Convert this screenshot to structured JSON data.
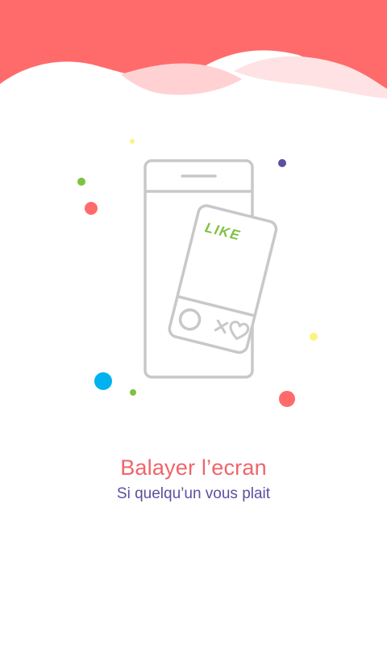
{
  "onboarding": {
    "title": "Balayer l’ecran",
    "subtitle": "Si quelqu’un vous plait",
    "card_stamp": "LIKE"
  },
  "colors": {
    "header": "#ff6b6b",
    "title": "#f0646a",
    "subtitle": "#5b4fa0",
    "like_stamp": "#7ec242",
    "outline": "#c8c8c8"
  },
  "icons": {
    "phone": "phone-outline-icon",
    "card": "profile-card-icon",
    "dislike": "x-icon",
    "like": "heart-icon"
  }
}
